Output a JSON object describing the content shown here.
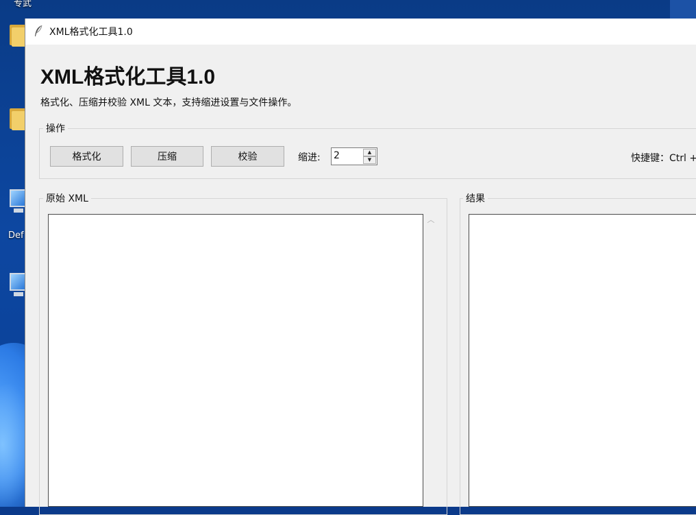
{
  "desktop": {
    "top_label": "专武",
    "icon_label_partial": "Def"
  },
  "window": {
    "title": "XML格式化工具1.0",
    "icon": "feather-icon"
  },
  "header": {
    "title": "XML格式化工具1.0",
    "subtitle": "格式化、压缩并校验 XML 文本，支持缩进设置与文件操作。"
  },
  "operations": {
    "legend": "操作",
    "buttons": [
      {
        "label": "格式化"
      },
      {
        "label": "压缩"
      },
      {
        "label": "校验"
      }
    ],
    "indent_label": "缩进:",
    "indent_value": "2",
    "shortcut_text": "快捷键：Ctrl +"
  },
  "source": {
    "legend": "原始 XML",
    "value": ""
  },
  "result": {
    "legend": "结果",
    "value": ""
  },
  "colors": {
    "window_bg": "#f0f0f0",
    "desktop_bg": "#0d47a1",
    "button_bg": "#e1e1e1"
  }
}
